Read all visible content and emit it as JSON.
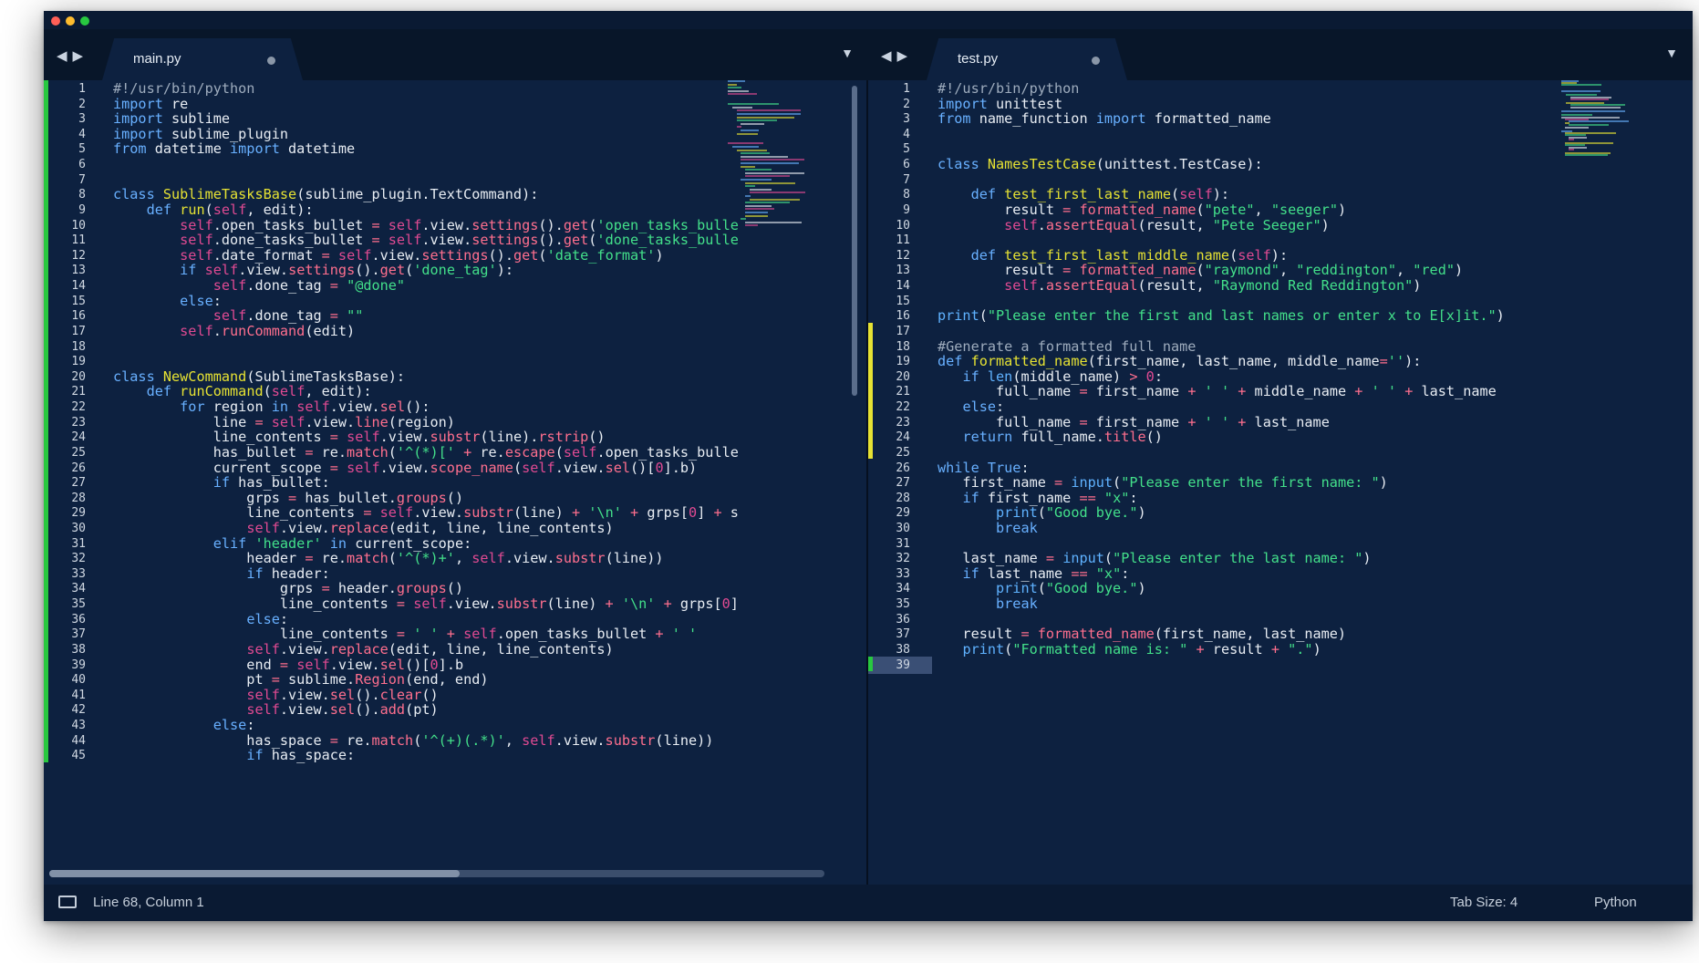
{
  "window": {
    "left_tab": {
      "name": "main.py"
    },
    "right_tab": {
      "name": "test.py"
    }
  },
  "editor_left": {
    "line_numbers": [
      "1",
      "2",
      "3",
      "4",
      "5",
      "6",
      "7",
      "8",
      "9",
      "10",
      "11",
      "12",
      "13",
      "14",
      "15",
      "16",
      "17",
      "18",
      "19",
      "20",
      "21",
      "22",
      "23",
      "24",
      "25",
      "26",
      "27",
      "28",
      "29",
      "30",
      "31",
      "32",
      "33",
      "34",
      "35",
      "36",
      "37",
      "38",
      "39",
      "40",
      "41",
      "42",
      "43",
      "44",
      "45"
    ],
    "lines": [
      "#!/usr/bin/python",
      "import re",
      "import sublime",
      "import sublime_plugin",
      "from datetime import datetime",
      "",
      "",
      "class SublimeTasksBase(sublime_plugin.TextCommand):",
      "    def run(self, edit):",
      "        self.open_tasks_bullet = self.view.settings().get('open_tasks_bulle",
      "        self.done_tasks_bullet = self.view.settings().get('done_tasks_bulle",
      "        self.date_format = self.view.settings().get('date_format')",
      "        if self.view.settings().get('done_tag'):",
      "            self.done_tag = \"@done\"",
      "        else:",
      "            self.done_tag = \"\"",
      "        self.runCommand(edit)",
      "",
      "",
      "class NewCommand(SublimeTasksBase):",
      "    def runCommand(self, edit):",
      "        for region in self.view.sel():",
      "            line = self.view.line(region)",
      "            line_contents = self.view.substr(line).rstrip()",
      "            has_bullet = re.match('^(*)[' + re.escape(self.open_tasks_bulle",
      "            current_scope = self.view.scope_name(self.view.sel()[0].b)",
      "            if has_bullet:",
      "                grps = has_bullet.groups()",
      "                line_contents = self.view.substr(line) + '\\n' + grps[0] + s",
      "                self.view.replace(edit, line, line_contents)",
      "            elif 'header' in current_scope:",
      "                header = re.match('^(*)+', self.view.substr(line))",
      "                if header:",
      "                    grps = header.groups()",
      "                    line_contents = self.view.substr(line) + '\\n' + grps[0]",
      "                else:",
      "                    line_contents = ' ' + self.open_tasks_bullet + ' '",
      "                self.view.replace(edit, line, line_contents)",
      "                end = self.view.sel()[0].b",
      "                pt = sublime.Region(end, end)",
      "                self.view.sel().clear()",
      "                self.view.sel().add(pt)",
      "            else:",
      "                has_space = re.match('^(+)(.*)', self.view.substr(line))",
      "                if has_space:"
    ]
  },
  "editor_right": {
    "line_numbers": [
      "1",
      "2",
      "3",
      "4",
      "5",
      "6",
      "7",
      "8",
      "9",
      "10",
      "11",
      "12",
      "13",
      "14",
      "15",
      "16",
      "17",
      "18",
      "19",
      "20",
      "21",
      "22",
      "23",
      "24",
      "25",
      "26",
      "27",
      "28",
      "29",
      "30",
      "31",
      "32",
      "33",
      "34",
      "35",
      "36",
      "37",
      "38",
      "39"
    ],
    "lines": [
      "#!/usr/bin/python",
      "import unittest",
      "from name_function import formatted_name",
      "",
      "",
      "class NamesTestCase(unittest.TestCase):",
      "",
      "    def test_first_last_name(self):",
      "        result = formatted_name(\"pete\", \"seeger\")",
      "        self.assertEqual(result, \"Pete Seeger\")",
      "",
      "    def test_first_last_middle_name(self):",
      "        result = formatted_name(\"raymond\", \"reddington\", \"red\")",
      "        self.assertEqual(result, \"Raymond Red Reddington\")",
      "",
      "print(\"Please enter the first and last names or enter x to E[x]it.\")",
      "",
      "#Generate a formatted full name",
      "def formatted_name(first_name, last_name, middle_name=''):",
      "   if len(middle_name) > 0:",
      "       full_name = first_name + ' ' + middle_name + ' ' + last_name",
      "   else:",
      "       full_name = first_name + ' ' + last_name",
      "   return full_name.title()",
      "",
      "while True:",
      "   first_name = input(\"Please enter the first name: \")",
      "   if first_name == \"x\":",
      "       print(\"Good bye.\")",
      "       break",
      "",
      "   last_name = input(\"Please enter the last name: \")",
      "   if last_name == \"x\":",
      "       print(\"Good bye.\")",
      "       break",
      "",
      "   result = formatted_name(first_name, last_name)",
      "   print(\"Formatted name is: \" + result + \".\")",
      ""
    ]
  },
  "statusbar": {
    "position": "Line 68, Column 1",
    "tab_size": "Tab Size: 4",
    "language": "Python"
  },
  "colors": {
    "background": "#0d2140",
    "keyword": "#68b0ff",
    "string": "#43e08a",
    "function": "#e6e233",
    "self": "#e04a92",
    "gutter_modified": "#e6e233",
    "gutter_added": "#28c840"
  }
}
